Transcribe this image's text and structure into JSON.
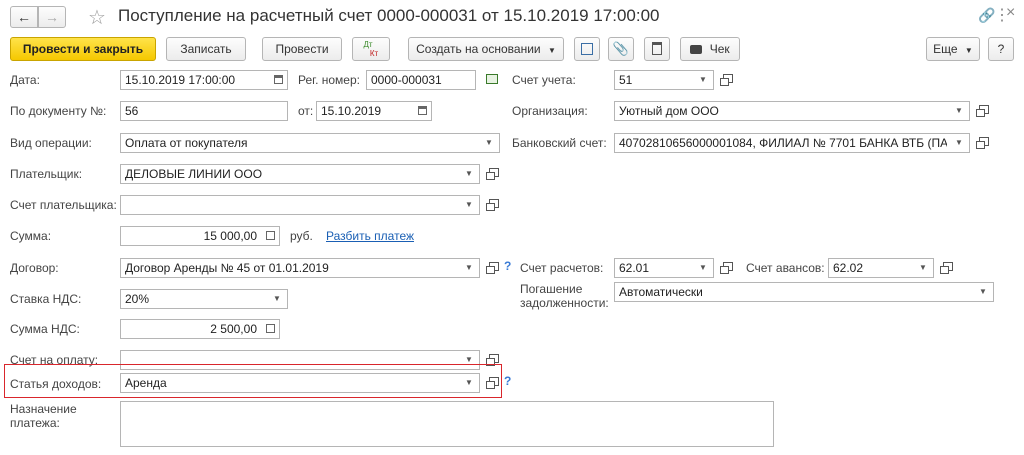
{
  "header": {
    "title": "Поступление на расчетный счет 0000-000031 от 15.10.2019 17:00:00"
  },
  "toolbar": {
    "post_close": "Провести и закрыть",
    "save": "Записать",
    "post": "Провести",
    "dt": "Дт",
    "kt": "Кт",
    "create_based": "Создать на основании",
    "check": "Чек",
    "more": "Еще",
    "help": "?"
  },
  "form": {
    "date_label": "Дата:",
    "date_value": "15.10.2019 17:00:00",
    "reg_label": "Рег. номер:",
    "reg_value": "0000-000031",
    "doc_label": "По документу №:",
    "doc_value": "56",
    "from_label": "от:",
    "from_value": "15.10.2019",
    "op_label": "Вид операции:",
    "op_value": "Оплата от покупателя",
    "payer_label": "Плательщик:",
    "payer_value": "ДЕЛОВЫЕ ЛИНИИ ООО",
    "payer_acc_label": "Счет плательщика:",
    "payer_acc_value": "",
    "sum_label": "Сумма:",
    "sum_value": "15 000,00",
    "currency": "руб.",
    "split_link": "Разбить платеж",
    "contract_label": "Договор:",
    "contract_value": "Договор Аренды  № 45 от 01.01.2019",
    "vat_rate_label": "Ставка НДС:",
    "vat_rate_value": "20%",
    "vat_sum_label": "Сумма НДС:",
    "vat_sum_value": "2 500,00",
    "invoice_label": "Счет на оплату:",
    "invoice_value": "",
    "income_label": "Статья доходов:",
    "income_value": "Аренда",
    "purpose_label_1": "Назначение",
    "purpose_label_2": "платежа:",
    "purpose_value": "",
    "account_label": "Счет учета:",
    "account_value": "51",
    "org_label": "Организация:",
    "org_value": "Уютный дом ООО",
    "bank_label": "Банковский счет:",
    "bank_value": "40702810656000001084, ФИЛИАЛ № 7701 БАНКА ВТБ (ПА",
    "settle_label": "Счет расчетов:",
    "settle_value": "62.01",
    "advance_label": "Счет авансов:",
    "advance_value": "62.02",
    "debt_label_1": "Погашение",
    "debt_label_2": "задолженности:",
    "debt_value": "Автоматически",
    "qmark": "?"
  },
  "colors": {
    "primary_button": "#f5c800",
    "highlight_border": "#d9262c",
    "link": "#1a5fb4"
  }
}
